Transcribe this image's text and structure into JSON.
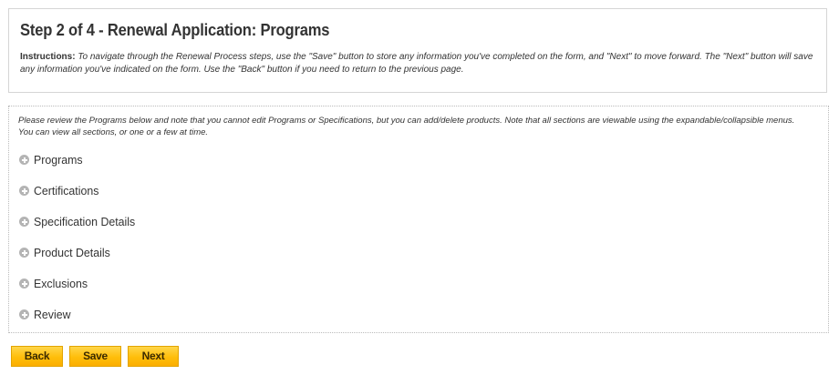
{
  "header": {
    "title": "Step 2 of 4 - Renewal Application: Programs",
    "instructions_label": "Instructions:",
    "instructions_text": "To navigate through the Renewal Process steps, use the \"Save\" button to store any information you've completed on the form, and \"Next\" to move forward. The \"Next\" button will save any information you've indicated on the form. Use the \"Back\" button if you need to return to the previous page."
  },
  "content": {
    "intro": "Please review the Programs below and note that you cannot edit Programs or Specifications, but you can add/delete products. Note that all sections are viewable using the expandable/collapsible menus. You can view all sections, or one or a few at time.",
    "sections": [
      {
        "label": "Programs",
        "icon": "plus-circle-icon"
      },
      {
        "label": "Certifications",
        "icon": "plus-circle-icon"
      },
      {
        "label": "Specification Details",
        "icon": "plus-circle-icon"
      },
      {
        "label": "Product Details",
        "icon": "plus-circle-icon"
      },
      {
        "label": "Exclusions",
        "icon": "plus-circle-icon"
      },
      {
        "label": "Review",
        "icon": "plus-circle-icon"
      }
    ]
  },
  "buttons": {
    "back_label": "Back",
    "save_label": "Save",
    "next_label": "Next"
  },
  "colors": {
    "button_fill": "#ffbe0a",
    "button_border": "#e3a300",
    "expand_icon": "#b4b4b4",
    "border": "#d5d5d5"
  }
}
